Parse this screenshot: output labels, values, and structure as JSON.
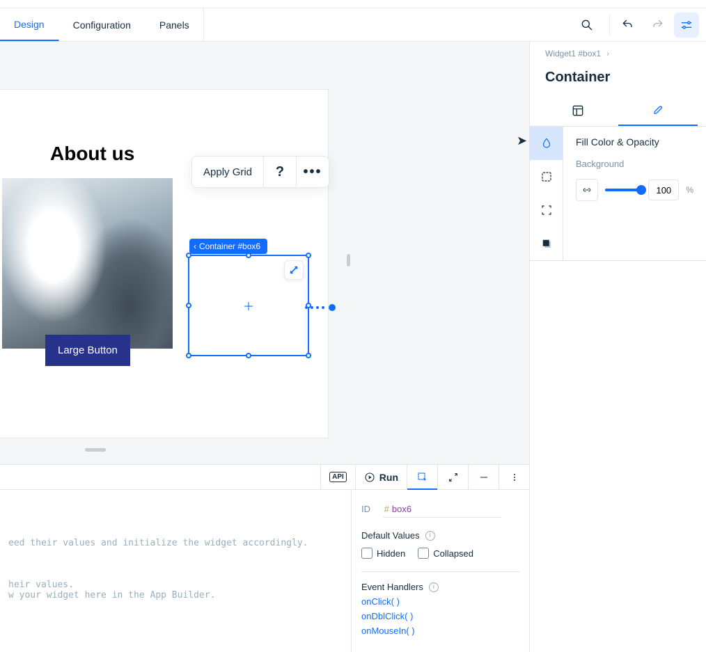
{
  "tabs": {
    "design": "Design",
    "configuration": "Configuration",
    "panels": "Panels"
  },
  "artboard": {
    "title": "About us",
    "button_label": "Large Button"
  },
  "floating_toolbar": {
    "apply_grid": "Apply Grid"
  },
  "selection": {
    "label": "Container #box6"
  },
  "inspector": {
    "breadcrumb": "Widget1 #box1",
    "title": "Container",
    "pane_title": "Fill Color & Opacity",
    "background_label": "Background",
    "opacity_value": "100",
    "opacity_unit": "%"
  },
  "bottom": {
    "api": "API",
    "run": "Run",
    "code_lines": "\n\n\need their values and initialize the widget accordingly.\n\n\n\nheir values.\nw your widget here in the App Builder.",
    "props": {
      "id_label": "ID",
      "id_hash": "#",
      "id_value": "box6",
      "default_values": "Default Values",
      "hidden": "Hidden",
      "collapsed": "Collapsed",
      "event_handlers": "Event Handlers",
      "onClick": "onClick( )",
      "onDblClick": "onDblClick( )",
      "onMouseIn": "onMouseIn( )"
    }
  }
}
